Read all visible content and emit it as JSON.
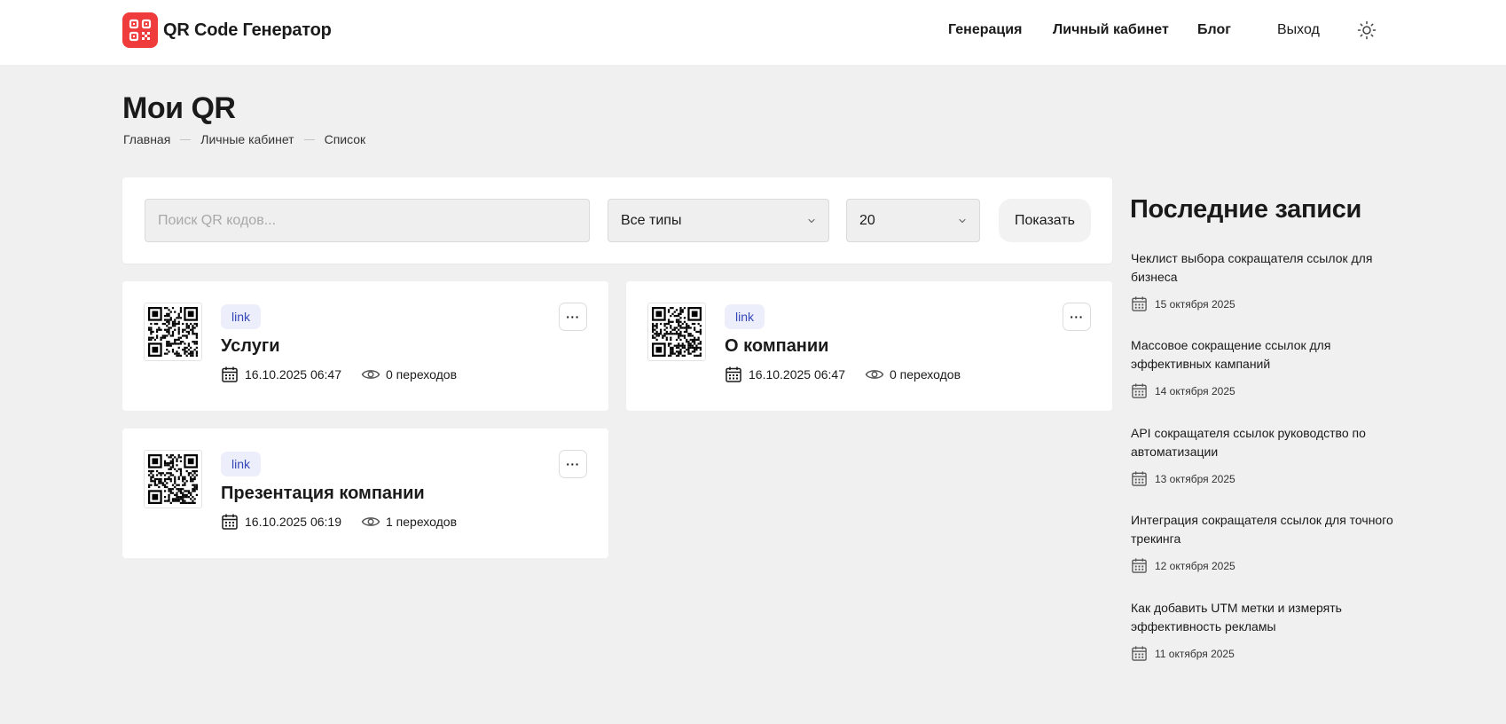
{
  "header": {
    "logo_text": "QR Code Генератор",
    "nav": {
      "generation": "Генерация",
      "account": "Личный кабинет",
      "blog": "Блог",
      "logout": "Выход"
    }
  },
  "page": {
    "title": "Мои QR",
    "breadcrumb": [
      "Главная",
      "Личные кабинет",
      "Список"
    ]
  },
  "filters": {
    "search_placeholder": "Поиск QR кодов...",
    "type_value": "Все типы",
    "count_value": "20",
    "show_label": "Показать"
  },
  "qr_items": [
    {
      "tag": "link",
      "title": "Услуги",
      "date": "16.10.2025 06:47",
      "clicks": "0 переходов",
      "more": "···"
    },
    {
      "tag": "link",
      "title": "О компании",
      "date": "16.10.2025 06:47",
      "clicks": "0 переходов",
      "more": "···"
    },
    {
      "tag": "link",
      "title": "Презентация компании",
      "date": "16.10.2025 06:19",
      "clicks": "1 переходов",
      "more": "···"
    }
  ],
  "sidebar": {
    "title": "Последние записи",
    "posts": [
      {
        "title": "Чеклист выбора сокращателя ссылок для бизнеса",
        "date": "15 октября 2025"
      },
      {
        "title": "Массовое сокращение ссылок для эффективных кампаний",
        "date": "14 октября 2025"
      },
      {
        "title": "API сокращателя ссылок руководство по автоматизации",
        "date": "13 октября 2025"
      },
      {
        "title": "Интеграция сокращателя ссылок для точного трекинга",
        "date": "12 октября 2025"
      },
      {
        "title": "Как добавить UTM метки и измерять эффективность рекламы",
        "date": "11 октября 2025"
      }
    ]
  },
  "colors": {
    "brand": "#ef3b3b",
    "page_bg": "#f0f0f0",
    "tag_bg": "#eceefb",
    "tag_text": "#3446b8"
  },
  "icons": {
    "logo": "qr-logo-icon",
    "theme": "sun-icon",
    "date": "calendar-icon",
    "views": "eye-icon",
    "select": "chevron-down-icon",
    "menu": "more-icon"
  }
}
